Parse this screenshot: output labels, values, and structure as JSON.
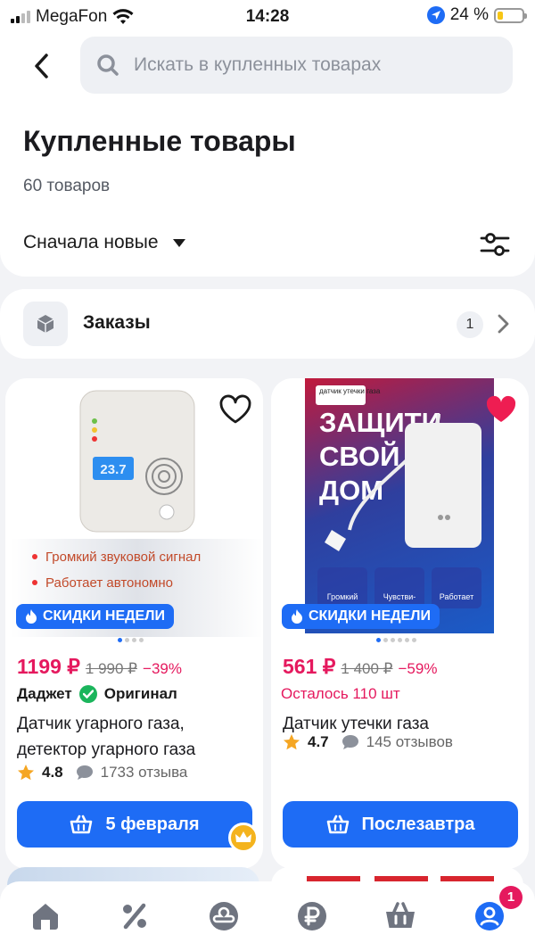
{
  "status": {
    "carrier": "MegaFon",
    "time": "14:28",
    "battery": "24 %"
  },
  "header": {
    "search_placeholder": "Искать в купленных товарах",
    "title": "Купленные товары",
    "count": "60 товаров",
    "sort_label": "Сначала новые"
  },
  "orders": {
    "label": "Заказы",
    "badge": "1"
  },
  "products": [
    {
      "badge": "СКИДКИ НЕДЕЛИ",
      "price": "1199 ₽",
      "old_price": "1 990 ₽",
      "discount": "−39%",
      "brand": "Даджет",
      "original_label": "Оригинал",
      "name": "Датчик угарного газа, детектор угарного газа",
      "rating": "4.8",
      "reviews": "1733 отзыва",
      "button": "5 февраля",
      "image_text_1": "Громкий звуковой сигнал",
      "image_text_2": "Работает автономно",
      "favorite": false
    },
    {
      "badge": "СКИДКИ НЕДЕЛИ",
      "price": "561 ₽",
      "old_price": "1 400 ₽",
      "discount": "−59%",
      "stock": "Осталось 110 шт",
      "name": "Датчик утечки газа",
      "rating": "4.7",
      "reviews": "145 отзывов",
      "button": "Послезавтра",
      "image_text_1": "ЗАЩИТИ СВОЙ ДОМ",
      "image_text_2": "датчик утечки газа",
      "favorite": true
    }
  ],
  "tabbar": {
    "profile_badge": "1"
  },
  "colors": {
    "accent": "#1e6cf5",
    "price": "#e5195e",
    "favorite": "#ee1d52"
  }
}
